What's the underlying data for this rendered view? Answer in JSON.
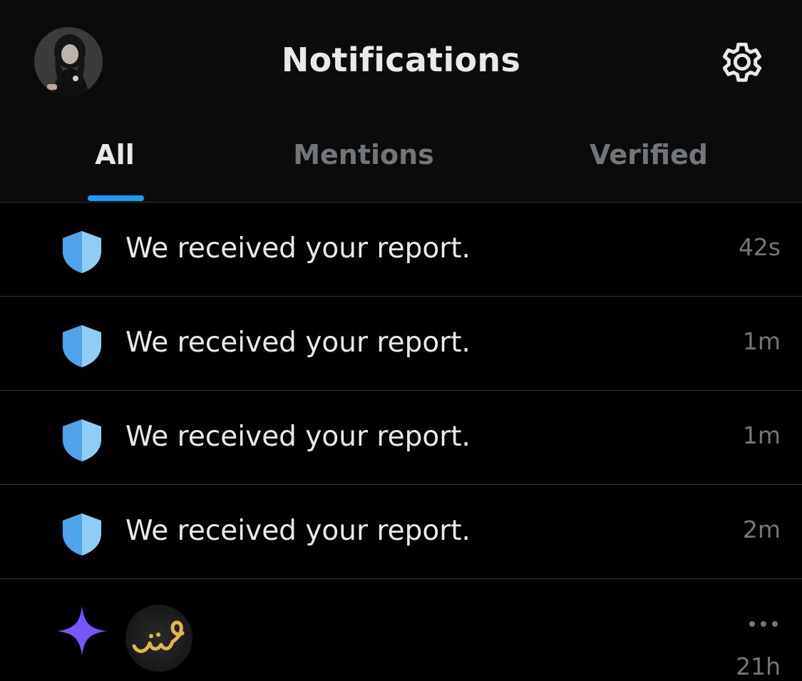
{
  "header": {
    "title": "Notifications",
    "avatar_icon": "profile-avatar",
    "settings_icon": "gear-icon"
  },
  "tabs": [
    {
      "label": "All",
      "active": true
    },
    {
      "label": "Mentions",
      "active": false
    },
    {
      "label": "Verified",
      "active": false
    }
  ],
  "notifications": [
    {
      "icon": "shield-icon",
      "text": "We received your report.",
      "time": "42s"
    },
    {
      "icon": "shield-icon",
      "text": "We received your report.",
      "time": "1m"
    },
    {
      "icon": "shield-icon",
      "text": "We received your report.",
      "time": "1m"
    },
    {
      "icon": "shield-icon",
      "text": "We received your report.",
      "time": "2m"
    }
  ],
  "partial_item": {
    "icon": "sparkle-icon",
    "avatar": "brand-avatar",
    "more_icon": "more-icon",
    "time": "21h"
  },
  "colors": {
    "background": "#000000",
    "header_background": "#0b0b0b",
    "text_primary": "#e7e9ea",
    "text_secondary": "#71767b",
    "accent": "#1d9bf0",
    "shield_light": "#8ecdf8",
    "shield_dark": "#4fa3ea",
    "sparkle": "#7856ff",
    "divider": "#2f3336"
  }
}
